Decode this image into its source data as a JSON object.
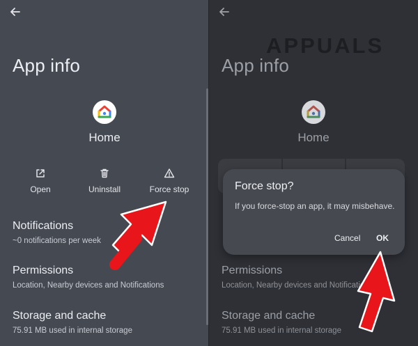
{
  "page": {
    "title": "App info"
  },
  "app": {
    "name": "Home",
    "icon": "google-home-icon"
  },
  "actions": {
    "open": {
      "label": "Open",
      "icon": "open-external-icon"
    },
    "uninstall": {
      "label": "Uninstall",
      "icon": "trash-icon"
    },
    "force_stop": {
      "label": "Force stop",
      "icon": "warning-triangle-icon"
    }
  },
  "settings": [
    {
      "title": "Notifications",
      "subtitle": "~0 notifications per week"
    },
    {
      "title": "Permissions",
      "subtitle": "Location, Nearby devices and Notifications"
    },
    {
      "title": "Storage and cache",
      "subtitle": "75.91 MB used in internal storage"
    }
  ],
  "dialog": {
    "title": "Force stop?",
    "body": "If you force-stop an app, it may misbehave.",
    "cancel_label": "Cancel",
    "ok_label": "OK"
  },
  "watermark": {
    "text": "APPUALS"
  },
  "colors": {
    "left_bg": "#454951",
    "right_bg": "#2e3036",
    "dialog_bg": "#46494f",
    "arrow": "#e8151b"
  }
}
